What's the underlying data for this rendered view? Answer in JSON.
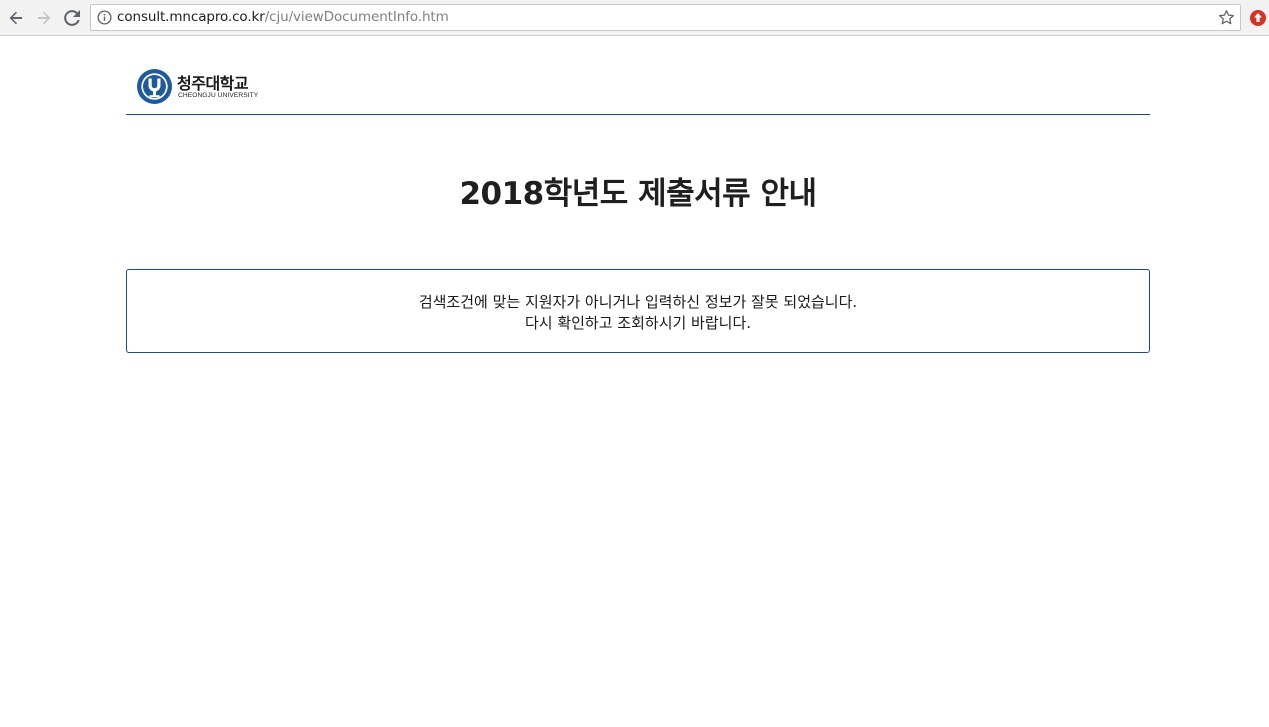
{
  "browser": {
    "url_host": "consult.mncapro.co.kr",
    "url_path": "/cju/viewDocumentInfo.htm",
    "icons": {
      "back": "back-arrow-icon",
      "forward": "forward-arrow-icon",
      "reload": "reload-icon",
      "info": "info-icon",
      "bookmark": "star-icon",
      "extension": "extension-icon"
    }
  },
  "header": {
    "logo_korean": "청주대학교",
    "logo_english": "CHEONGJU UNIVERSITY"
  },
  "main": {
    "title": "2018학년도 제출서류 안내",
    "notice": {
      "line1": "검색조건에 맞는 지원자가 아니거나 입력하신 정보가 잘못 되었습니다.",
      "line2": "다시 확인하고 조회하시기 바랍니다."
    }
  },
  "colors": {
    "accent": "#1e4c80",
    "extension_badge": "#d93025"
  }
}
